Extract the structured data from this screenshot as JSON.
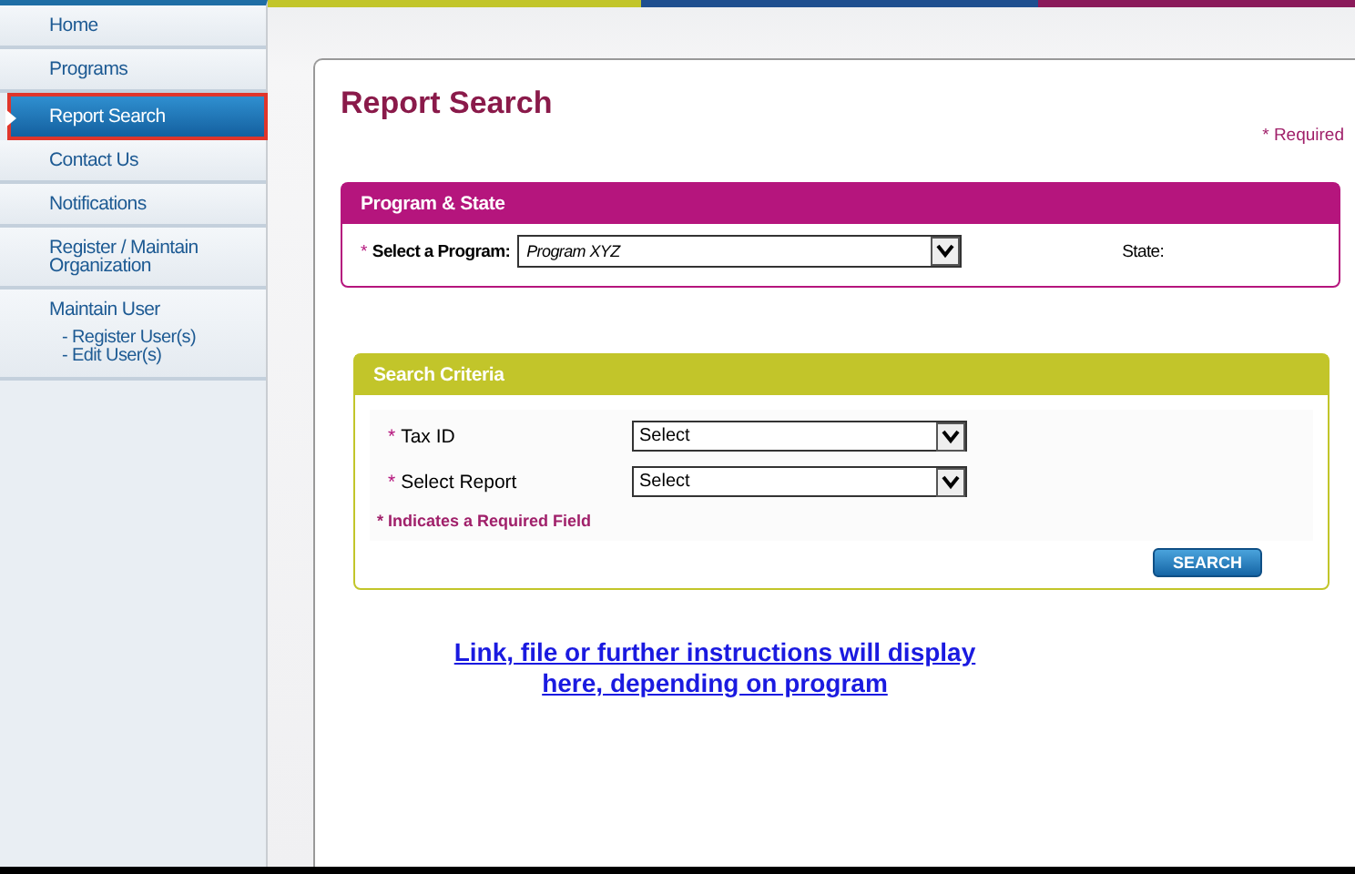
{
  "sidebar": {
    "items": [
      {
        "label": "Home",
        "selected": false
      },
      {
        "label": "Programs",
        "selected": false
      },
      {
        "label": "Report Search",
        "selected": true
      },
      {
        "label": "Contact Us",
        "selected": false
      },
      {
        "label": "Notifications",
        "selected": false
      },
      {
        "label": "Register / Maintain Organization",
        "selected": false
      },
      {
        "label": "Maintain User",
        "selected": false,
        "children": [
          {
            "label": "- Register User(s)"
          },
          {
            "label": "- Edit User(s)"
          }
        ]
      }
    ]
  },
  "page": {
    "title": "Report Search",
    "required_note": "* Required"
  },
  "program_state": {
    "title": "Program & State",
    "required_mark": "*",
    "program_label": "Select a Program:",
    "program_value": "Program XYZ",
    "state_label": "State:"
  },
  "search_criteria": {
    "title": "Search Criteria",
    "fields": [
      {
        "required_mark": "*",
        "label": "Tax ID",
        "value": "Select"
      },
      {
        "required_mark": "*",
        "label": "Select Report",
        "value": "Select"
      }
    ],
    "required_note": "* Indicates a Required Field",
    "search_button": "SEARCH"
  },
  "link": {
    "lines": [
      "Link, file or further instructions will display",
      "here, depending on program"
    ]
  }
}
